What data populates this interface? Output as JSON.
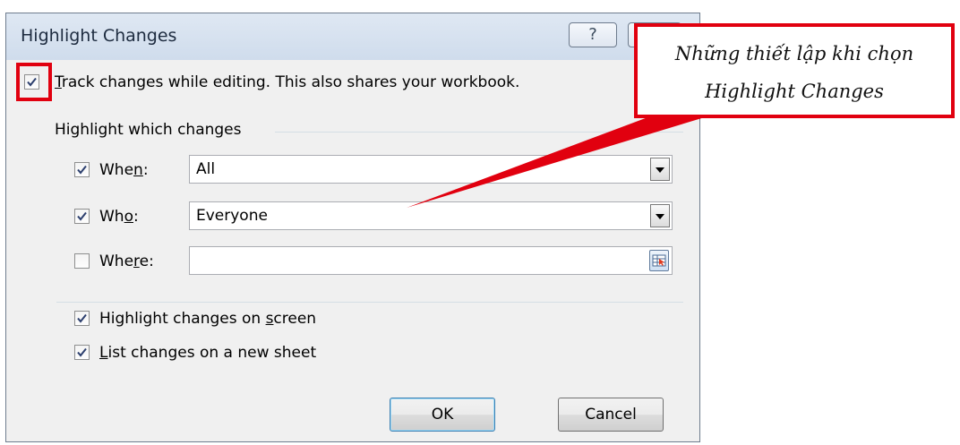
{
  "dialog": {
    "title": "Highlight Changes",
    "help_glyph": "?",
    "track_changes": {
      "label_first": "T",
      "label_rest": "rack changes while editing. This also shares your workbook.",
      "checked": true
    },
    "group_label": "Highlight which changes",
    "when": {
      "label_pre": "Whe",
      "label_key": "n",
      "label_post": ":",
      "checked": true,
      "value": "All"
    },
    "who": {
      "label_pre": "Wh",
      "label_key": "o",
      "label_post": ":",
      "checked": true,
      "value": "Everyone"
    },
    "where": {
      "label_pre": "Whe",
      "label_key": "r",
      "label_post": "e:",
      "checked": false,
      "value": ""
    },
    "highlight_on_screen": {
      "label_pre": "Highlight changes on ",
      "label_key": "s",
      "label_post": "creen",
      "checked": true
    },
    "list_on_new_sheet": {
      "label_pre": "",
      "label_key": "L",
      "label_post": "ist changes on a new sheet",
      "checked": true
    },
    "ok_label": "OK",
    "cancel_label": "Cancel"
  },
  "annotation": {
    "line1": "Những thiết lập khi chọn",
    "line2": "Highlight Changes",
    "color": "#e1000f"
  }
}
